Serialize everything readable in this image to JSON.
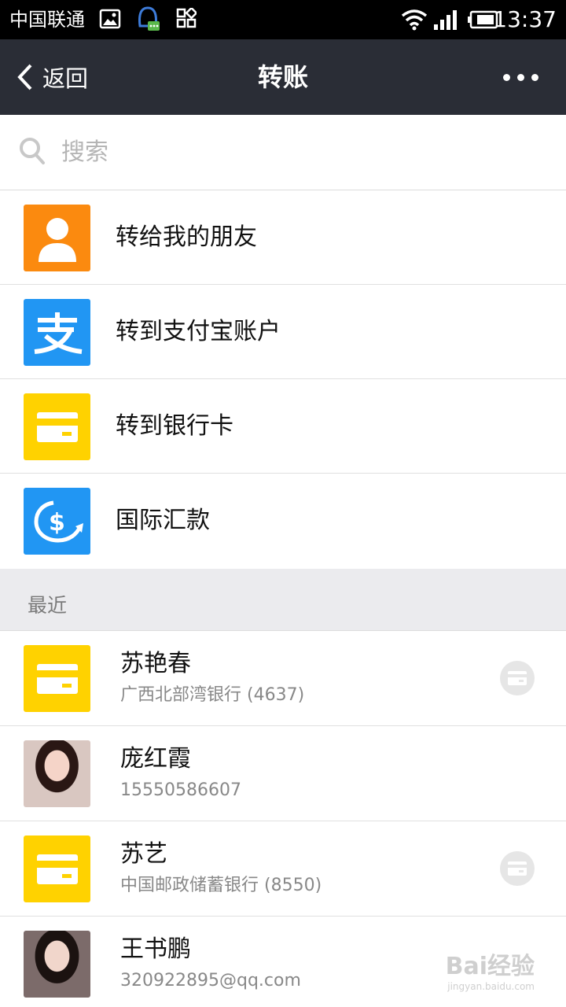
{
  "status_bar": {
    "carrier": "中国联通",
    "time": "13:37",
    "icons": [
      "image-icon",
      "qq-icon",
      "apps-icon",
      "wifi-icon",
      "signal-icon",
      "battery-icon"
    ]
  },
  "nav": {
    "back_label": "返回",
    "title": "转账",
    "more_icon": "more-dots-icon",
    "bg_color": "#2a2d36"
  },
  "search": {
    "placeholder": "搜索",
    "icon": "search-icon"
  },
  "menu": [
    {
      "label": "转给我的朋友",
      "icon": "person-icon",
      "color": "#fb8a0f"
    },
    {
      "label": "转到支付宝账户",
      "icon": "alipay-icon",
      "color": "#2196f3"
    },
    {
      "label": "转到银行卡",
      "icon": "bank-card-icon",
      "color": "#ffd200"
    },
    {
      "label": "国际汇款",
      "icon": "dollar-exchange-icon",
      "color": "#2196f3"
    }
  ],
  "recent": {
    "header": "最近",
    "items": [
      {
        "name": "苏艳春",
        "sub": "广西北部湾银行 (4637)",
        "icon": "bank-card-icon",
        "trail": "card-badge-icon"
      },
      {
        "name": "庞红霞",
        "sub": "15550586607",
        "icon": "avatar-photo"
      },
      {
        "name": "苏艺",
        "sub": "中国邮政储蓄银行 (8550)",
        "icon": "bank-card-icon",
        "trail": "card-badge-icon"
      },
      {
        "name": "王书鹏",
        "sub": "320922895@qq.com",
        "icon": "avatar-photo"
      }
    ]
  },
  "watermark": {
    "main": "Bai经验",
    "sub": "jingyan.baidu.com"
  }
}
